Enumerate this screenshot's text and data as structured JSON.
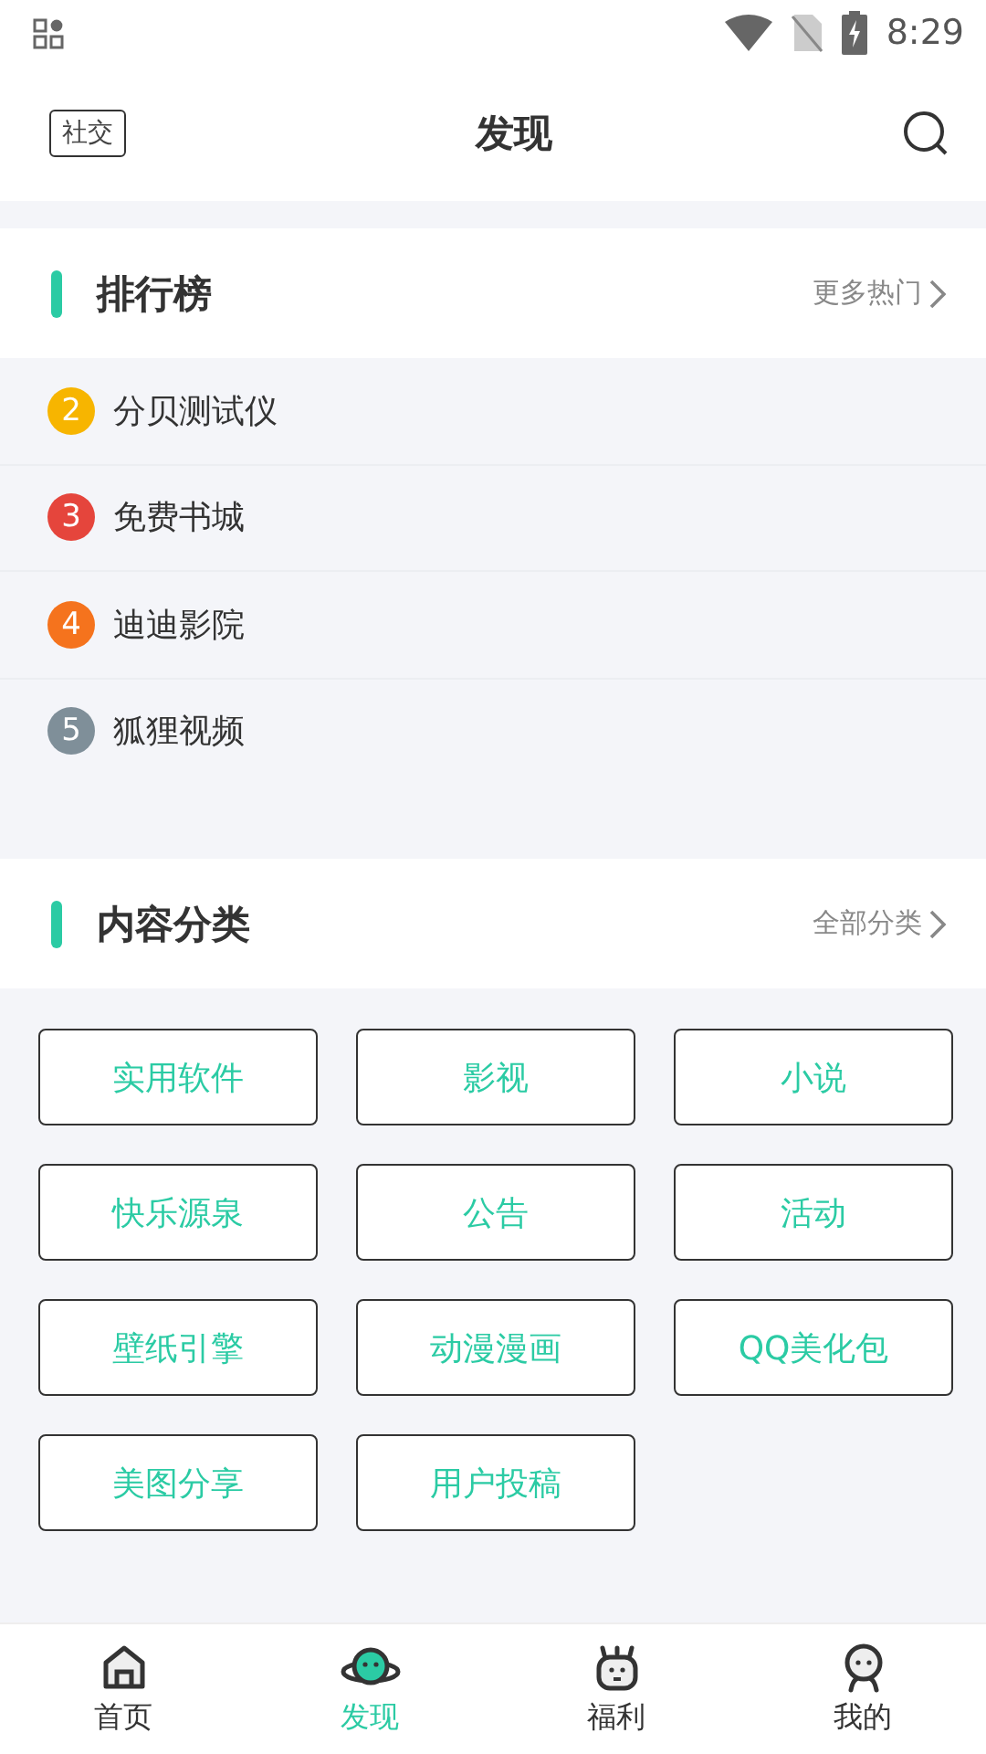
{
  "status_bar": {
    "time": "8:29"
  },
  "header": {
    "left_tag": "社交",
    "title": "发现"
  },
  "ranking": {
    "title": "排行榜",
    "more": "更多热门",
    "items": [
      {
        "rank": "2",
        "name": "分贝测试仪",
        "color": "#f7b500"
      },
      {
        "rank": "3",
        "name": "免费书城",
        "color": "#e5453c"
      },
      {
        "rank": "4",
        "name": "迪迪影院",
        "color": "#f5731d"
      },
      {
        "rank": "5",
        "name": "狐狸视频",
        "color": "#7f8f99"
      }
    ]
  },
  "categories": {
    "title": "内容分类",
    "more": "全部分类",
    "items": [
      "实用软件",
      "影视",
      "小说",
      "快乐源泉",
      "公告",
      "活动",
      "壁纸引擎",
      "动漫漫画",
      "QQ美化包",
      "美图分享",
      "用户投稿"
    ]
  },
  "bottom_nav": [
    {
      "label": "首页",
      "kind": "home",
      "selected": false
    },
    {
      "label": "发现",
      "kind": "planet",
      "selected": true
    },
    {
      "label": "福利",
      "kind": "robot",
      "selected": false
    },
    {
      "label": "我的",
      "kind": "person",
      "selected": false
    }
  ]
}
